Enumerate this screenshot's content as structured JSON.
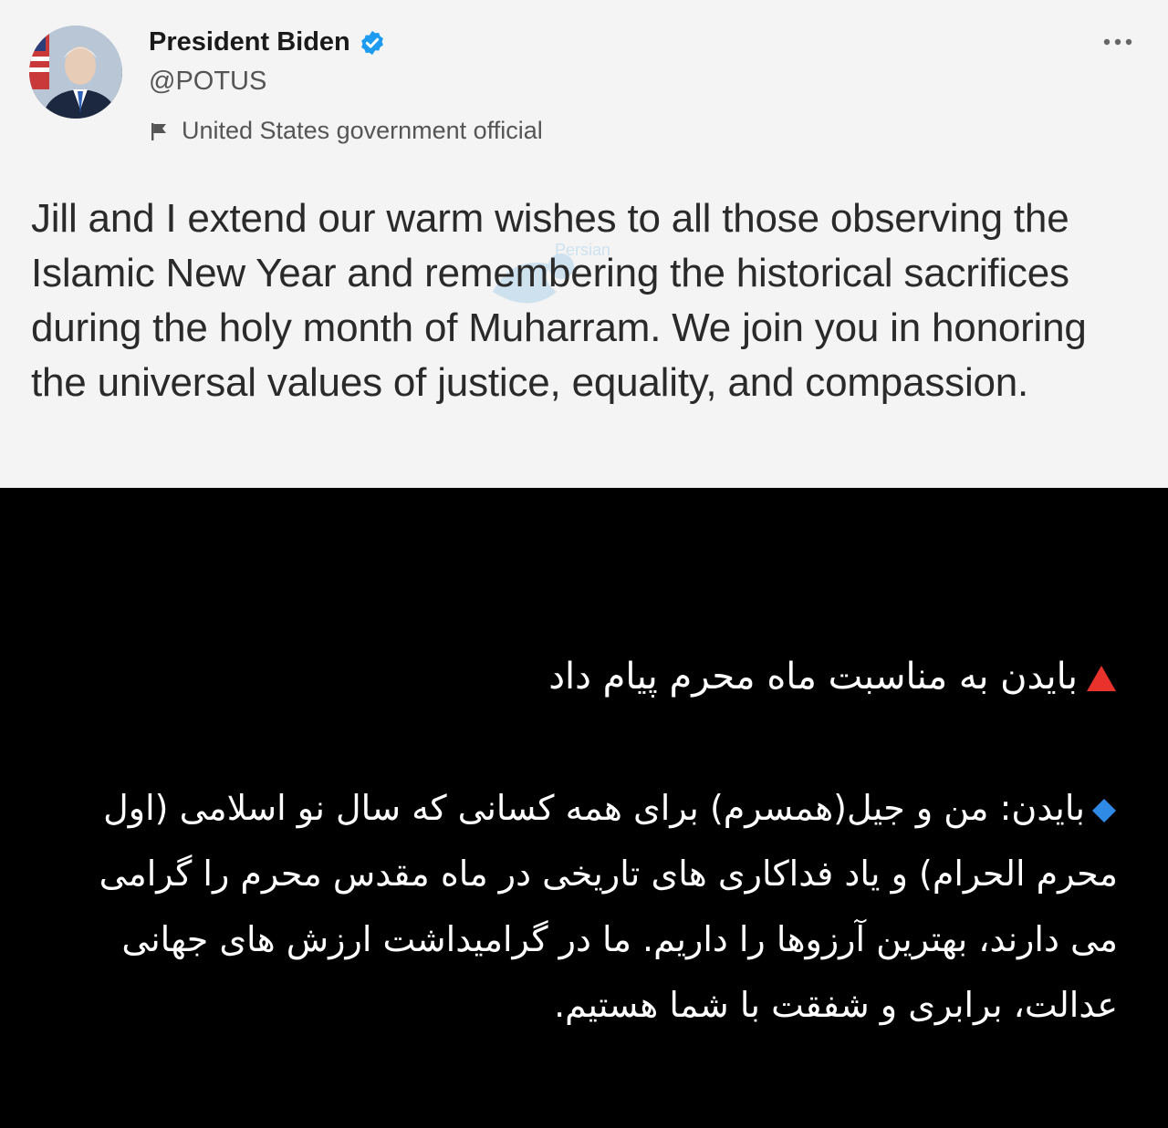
{
  "tweet": {
    "display_name": "President Biden",
    "handle": "@POTUS",
    "label": "United States government official",
    "text": "Jill and I extend our warm wishes to all those observing the Islamic New Year and remembering the historical sacrifices during the holy month of Muharram. We join you in honoring the universal values of justice, equality, and compassion.",
    "verified_icon": "verified-badge-icon",
    "more_icon": "more-options-icon",
    "flag_icon": "government-flag-icon",
    "colors": {
      "verified": "#1d9bf0",
      "card_bg": "#f4f4f4"
    }
  },
  "watermark": {
    "text": "Persian"
  },
  "caption": {
    "headline": "بایدن به مناسبت ماه محرم پیام داد",
    "headline_marker": "red-triangle-icon",
    "body": "بایدن: من و جیل(همسرم) برای همه کسانی که سال نو اسلامی (اول محرم الحرام) و یاد فداکاری های تاریخی در ماه مقدس محرم را گرامی می دارند، بهترین آرزوها را داریم. ما در گرامیداشت ارزش های جهانی عدالت، برابری و شفقت با شما هستیم.",
    "body_marker": "blue-diamond-icon",
    "colors": {
      "background": "#000000",
      "text": "#ffffff",
      "triangle": "#e8322b",
      "diamond": "#2f8ae6"
    }
  }
}
